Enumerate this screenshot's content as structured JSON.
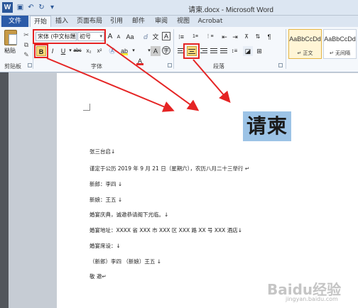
{
  "window": {
    "title": "请柬.docx - Microsoft Word"
  },
  "quick_access": {
    "save_icon": "save-icon",
    "undo_icon": "undo-icon",
    "redo_icon": "redo-icon"
  },
  "tabs": [
    {
      "label": "文件"
    },
    {
      "label": "开始"
    },
    {
      "label": "插入"
    },
    {
      "label": "页面布局"
    },
    {
      "label": "引用"
    },
    {
      "label": "邮件"
    },
    {
      "label": "审阅"
    },
    {
      "label": "视图"
    },
    {
      "label": "Acrobat"
    }
  ],
  "clipboard": {
    "paste_label": "粘贴",
    "group_label": "剪贴板"
  },
  "font": {
    "font_name": "宋体 (中文标题",
    "font_size": "初号",
    "group_label": "字体",
    "grow": "A",
    "shrink": "A",
    "aa": "Aa",
    "bold": "B",
    "italic": "I",
    "underline": "U",
    "strike": "abc",
    "subscript": "x₂",
    "superscript": "x²",
    "font_color_letter": "A",
    "char_border": "A",
    "phonetic": "文",
    "enclose": "字"
  },
  "paragraph": {
    "group_label": "段落"
  },
  "styles": [
    {
      "sample": "AaBbCcDd",
      "name": "↵ 正文"
    },
    {
      "sample": "AaBbCcDd",
      "name": "↵ 无间隔"
    }
  ],
  "colors": {
    "accent_tab": "#2b5ba8",
    "highlight": "#9cc3e6",
    "annotation_red": "#e52424",
    "active_button": "#f9d979"
  },
  "document": {
    "title": "请柬",
    "lines": [
      "张三台启↓",
      "谨定于公历 2019 年 9 月 21 日（星期六），农历八月二十三举行 ↵",
      "新郎：李四 ↓",
      "新娘：王五 ↓",
      "婚宴庆典，诚邀恭请阁下光临。↓",
      "婚宴地址：XXXX 省 XXX 市 XXX 区 XXX 路 XX 号 XXX 酒店↓",
      "婚宴席设：↓",
      "（新郎）李四 （新娘）王五 ↓",
      "敬 邀↵"
    ]
  },
  "watermark": {
    "big": "Baidu经验",
    "small": "jingyan.baidu.com"
  }
}
